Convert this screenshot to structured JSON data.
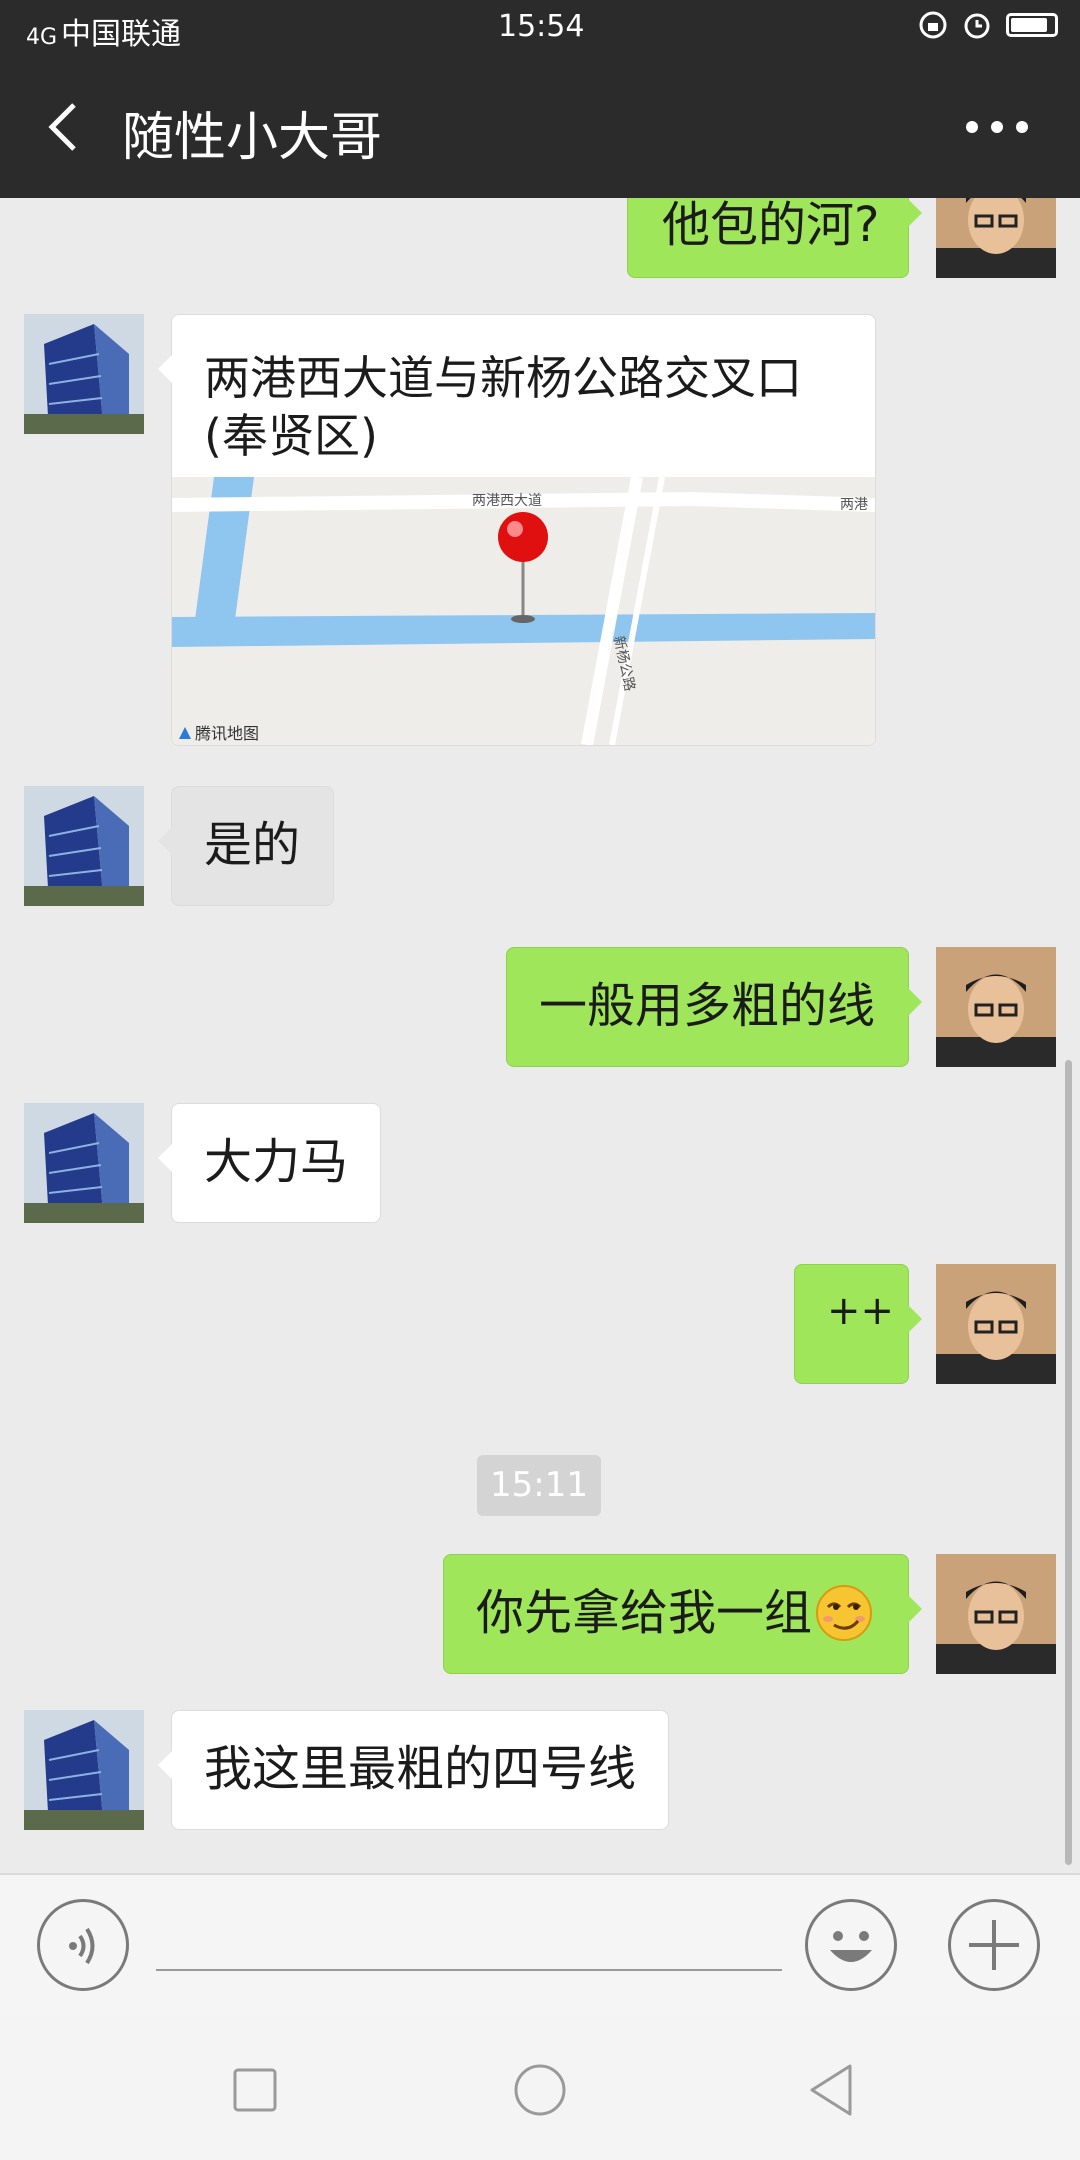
{
  "status_bar": {
    "network": "4G",
    "carrier": "中国联通",
    "time": "15:54"
  },
  "header": {
    "title": "随性小大哥"
  },
  "messages": [
    {
      "side": "out",
      "text": "他包的河?"
    },
    {
      "side": "in",
      "type": "location",
      "address": "两港西大道与新杨公路交叉口(奉贤区)",
      "map_road_1": "两港西大道",
      "map_road_1b": "两港",
      "map_road_2": "新杨公路",
      "map_brand": "腾讯地图"
    },
    {
      "side": "in",
      "text": "是的"
    },
    {
      "side": "out",
      "text": "一般用多粗的线"
    },
    {
      "side": "in",
      "text": "大力马"
    },
    {
      "side": "out",
      "text": "++"
    },
    {
      "side": "out",
      "text": "你先拿给我一组"
    },
    {
      "side": "in",
      "text": "我这里最粗的四号线"
    }
  ],
  "timestamp": "15:11",
  "colors": {
    "header_bg": "#2b2b2b",
    "chat_bg": "#ebebeb",
    "out_bubble": "#9fe65a",
    "in_bubble": "#ffffff",
    "map_water": "#8ec6f0",
    "pin": "#e01010"
  },
  "icons": {
    "back": "chevron-left",
    "more": "three-dots",
    "voice": "voice-waves",
    "emoji": "smiley",
    "add": "plus",
    "nav_recent": "square",
    "nav_home": "circle",
    "nav_back": "triangle"
  }
}
